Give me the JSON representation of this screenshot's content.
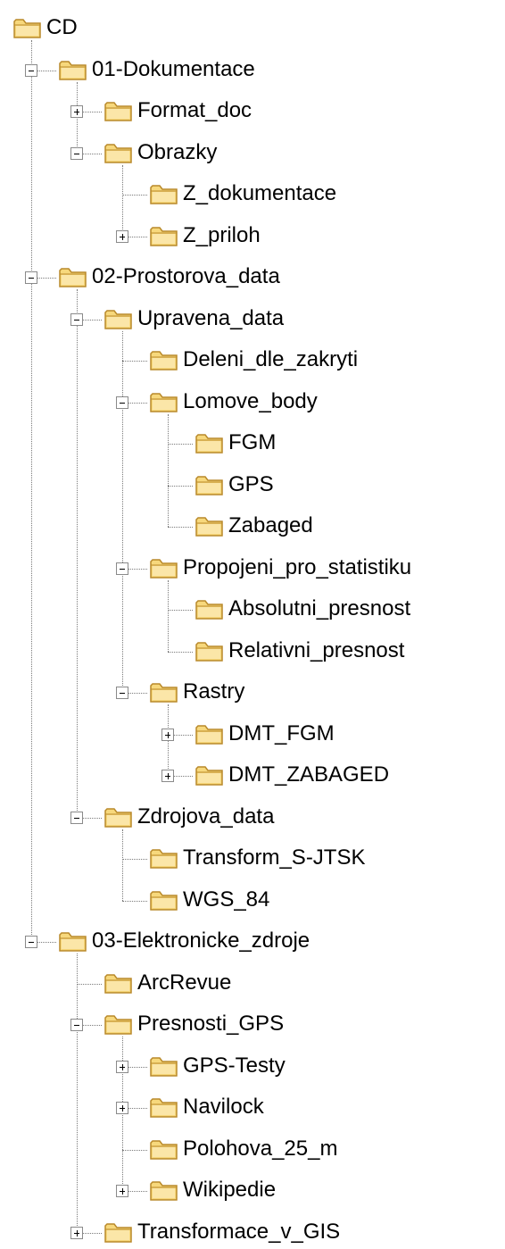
{
  "tree": {
    "nodes": [
      {
        "label": "CD",
        "level": 0,
        "expanded": true
      },
      {
        "label": "01-Dokumentace",
        "level": 1,
        "expanded": true
      },
      {
        "label": "Format_doc",
        "level": 2,
        "expanded": false,
        "has_children": true
      },
      {
        "label": "Obrazky",
        "level": 2,
        "expanded": true
      },
      {
        "label": "Z_dokumentace",
        "level": 3
      },
      {
        "label": "Z_priloh",
        "level": 3,
        "expanded": false,
        "has_children": true
      },
      {
        "label": "02-Prostorova_data",
        "level": 1,
        "expanded": true
      },
      {
        "label": "Upravena_data",
        "level": 2,
        "expanded": true
      },
      {
        "label": "Deleni_dle_zakryti",
        "level": 3
      },
      {
        "label": "Lomove_body",
        "level": 3,
        "expanded": true
      },
      {
        "label": "FGM",
        "level": 4
      },
      {
        "label": "GPS",
        "level": 4
      },
      {
        "label": "Zabaged",
        "level": 4
      },
      {
        "label": "Propojeni_pro_statistiku",
        "level": 3,
        "expanded": true
      },
      {
        "label": "Absolutni_presnost",
        "level": 4
      },
      {
        "label": "Relativni_presnost",
        "level": 4
      },
      {
        "label": "Rastry",
        "level": 3,
        "expanded": true
      },
      {
        "label": "DMT_FGM",
        "level": 4,
        "expanded": false,
        "has_children": true
      },
      {
        "label": "DMT_ZABAGED",
        "level": 4,
        "expanded": false,
        "has_children": true
      },
      {
        "label": "Zdrojova_data",
        "level": 2,
        "expanded": true
      },
      {
        "label": "Transform_S-JTSK",
        "level": 3
      },
      {
        "label": "WGS_84",
        "level": 3
      },
      {
        "label": "03-Elektronicke_zdroje",
        "level": 1,
        "expanded": true
      },
      {
        "label": "ArcRevue",
        "level": 2
      },
      {
        "label": "Presnosti_GPS",
        "level": 2,
        "expanded": true
      },
      {
        "label": "GPS-Testy",
        "level": 3,
        "expanded": false,
        "has_children": true
      },
      {
        "label": "Navilock",
        "level": 3,
        "expanded": false,
        "has_children": true
      },
      {
        "label": "Polohova_25_m",
        "level": 3
      },
      {
        "label": "Wikipedie",
        "level": 3,
        "expanded": false,
        "has_children": true
      },
      {
        "label": "Transformace_v_GIS",
        "level": 2,
        "expanded": false,
        "has_children": true
      }
    ]
  },
  "colors": {
    "folder_fill": "#f7d87c",
    "folder_outline": "#b9892a",
    "line": "#7a7a7a",
    "text": "#000000"
  },
  "icons": {
    "folder": "folder-icon",
    "expand": "plus-icon",
    "collapse": "minus-icon"
  }
}
